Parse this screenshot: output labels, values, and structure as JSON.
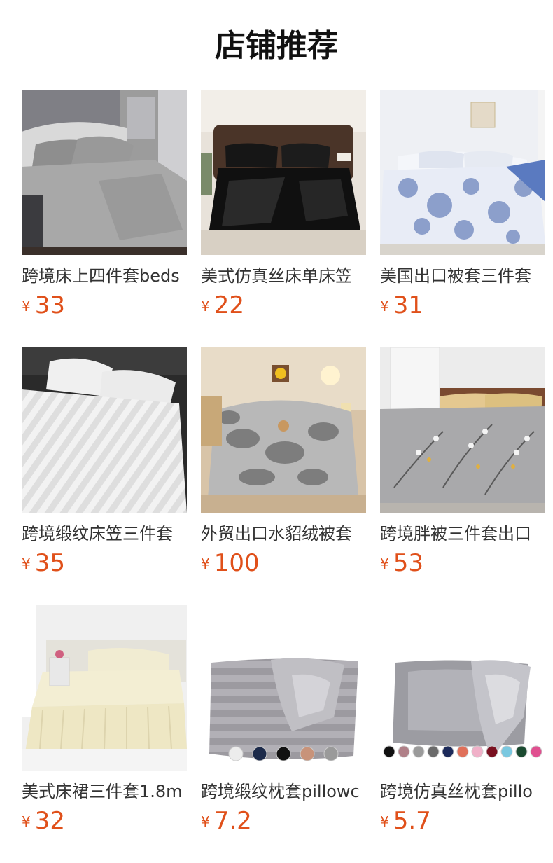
{
  "section": {
    "title": "店铺推荐"
  },
  "currency_symbol": "¥",
  "products": [
    {
      "name": "跨境床上四件套beds",
      "price": "33",
      "image": "grey-sheet-set"
    },
    {
      "name": "美式仿真丝床单床笠",
      "price": "22",
      "image": "black-satin-bedding"
    },
    {
      "name": "美国出口被套三件套",
      "price": "31",
      "image": "blue-floral-duvet"
    },
    {
      "name": "跨境缎纹床笠三件套",
      "price": "35",
      "image": "white-stripe-sheets"
    },
    {
      "name": "外贸出口水貂绒被套",
      "price": "100",
      "image": "grey-faux-fur-bedding"
    },
    {
      "name": "跨境胖被三件套出口",
      "price": "53",
      "image": "grey-branch-comforter"
    },
    {
      "name": "美式床裙三件套1.8m",
      "price": "32",
      "image": "cream-bed-skirt"
    },
    {
      "name": "跨境缎纹枕套pillowc",
      "price": "7.2",
      "image": "striped-satin-pillowcase"
    },
    {
      "name": "跨境仿真丝枕套pillo",
      "price": "5.7",
      "image": "silver-silk-pillowcase"
    }
  ],
  "swatches": {
    "striped_pillowcase": [
      "#ececec",
      "#1c2a4a",
      "#111111",
      "#c8937a",
      "#9a9a9a"
    ],
    "silk_pillowcase": [
      "#111111",
      "#b08088",
      "#9a9a9a",
      "#6a6a6a",
      "#1c2a5a",
      "#e0705a",
      "#f0b0c8",
      "#7a1020",
      "#7ac8e0",
      "#1a4a30",
      "#e05090"
    ]
  }
}
